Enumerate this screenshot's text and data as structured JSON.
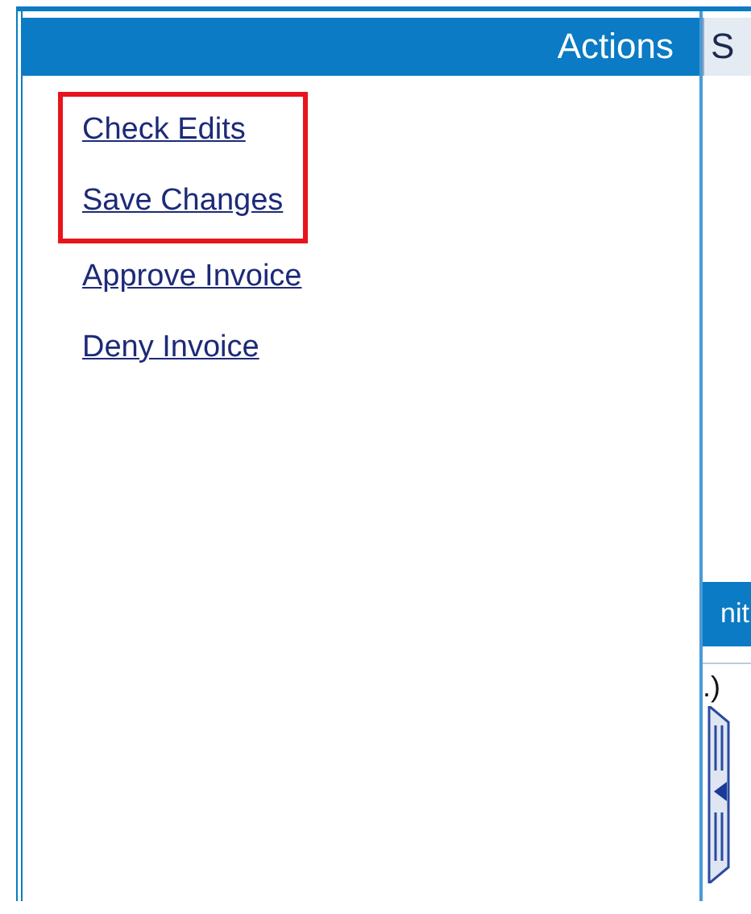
{
  "actions_panel": {
    "title": "Actions",
    "links": [
      {
        "label": "Check Edits",
        "highlighted": true
      },
      {
        "label": "Save Changes",
        "highlighted": true
      },
      {
        "label": "Approve Invoice",
        "highlighted": false
      },
      {
        "label": "Deny Invoice",
        "highlighted": false
      }
    ]
  },
  "side_panel": {
    "header": "S",
    "section_header": "nit",
    "text": ".)"
  }
}
